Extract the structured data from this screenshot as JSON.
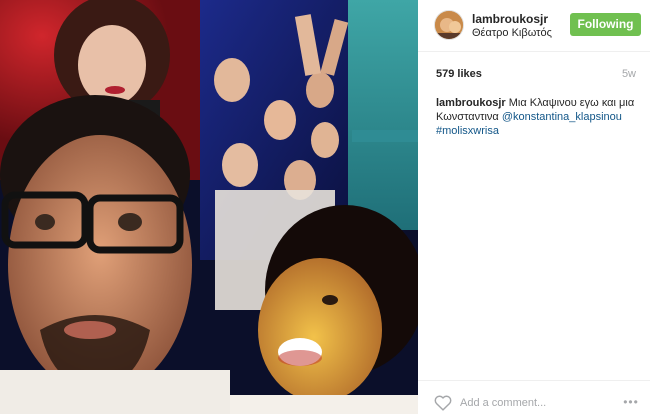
{
  "post": {
    "photo_alt": "",
    "username": "lambroukosjr",
    "location": "Θέατρο Κιβωτός",
    "follow_button": "Following",
    "likes": "579 likes",
    "time_ago": "5w",
    "caption": {
      "user": "lambroukosjr",
      "text": " Μια Κλαψινου εγω και μια Κωνσταντινα ",
      "mention": "@konstantina_klapsinou",
      "hashtag": "#molisxwrisa"
    },
    "comment_placeholder": "Add a comment...",
    "more_label": "•••"
  },
  "colors": {
    "following_green": "#70c050",
    "link_blue": "#125688",
    "muted_gray": "#a5a7aa"
  },
  "icons": [
    "heart-icon",
    "more-options-icon"
  ]
}
